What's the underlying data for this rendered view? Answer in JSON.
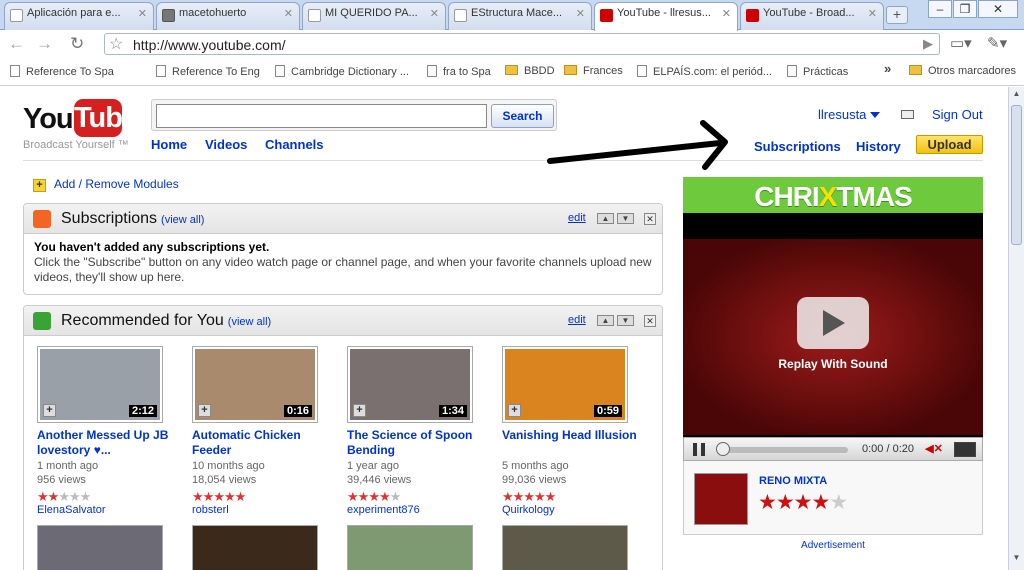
{
  "browser": {
    "tabs": [
      {
        "title": "Aplicación para e...",
        "icon": "page-icon"
      },
      {
        "title": "macetohuerto",
        "icon": "apple-icon"
      },
      {
        "title": "MI QUERIDO PA...",
        "icon": "page-icon"
      },
      {
        "title": "EStructura Mace...",
        "icon": "page-icon"
      },
      {
        "title": "YouTube - llresus...",
        "icon": "youtube-icon"
      },
      {
        "title": "YouTube - Broad...",
        "icon": "youtube-icon"
      }
    ],
    "url": "http://www.youtube.com/",
    "bookmarks": [
      {
        "label": "Reference To Spa",
        "icon": "page"
      },
      {
        "label": "Reference To Eng",
        "icon": "page"
      },
      {
        "label": "Cambridge Dictionary ...",
        "icon": "page"
      },
      {
        "label": "fra to Spa",
        "icon": "page"
      },
      {
        "label": "BBDD",
        "icon": "folder"
      },
      {
        "label": "Frances",
        "icon": "folder"
      },
      {
        "label": "ELPAÍS.com: el periód...",
        "icon": "page"
      },
      {
        "label": "Prácticas",
        "icon": "page"
      }
    ],
    "overflow": "»",
    "other_bookmarks": "Otros marcadores"
  },
  "header": {
    "logo_you": "You",
    "logo_tube": "Tube",
    "tagline": "Broadcast Yourself ™",
    "search_button": "Search",
    "nav": [
      "Home",
      "Videos",
      "Channels"
    ],
    "username": "llresusta",
    "sign_out": "Sign Out",
    "subscriptions": "Subscriptions",
    "history": "History",
    "upload": "Upload"
  },
  "add_modules": "Add / Remove Modules",
  "subscriptions_module": {
    "title": "Subscriptions",
    "view_all": "(view all)",
    "edit": "edit",
    "empty_title": "You haven't added any subscriptions yet.",
    "empty_text": "Click the \"Subscribe\" button on any video watch page or channel page, and when your favorite channels upload new videos, they'll show up here."
  },
  "recommended_module": {
    "title": "Recommended for You",
    "view_all": "(view all)",
    "edit": "edit",
    "videos": [
      {
        "title": "Another Messed Up JB lovestory ♥...",
        "age": "1 month ago",
        "views": "956 views",
        "rating": 2,
        "user": "ElenaSalvator",
        "duration": "2:12",
        "thumb_color": "#9aa0a8"
      },
      {
        "title": "Automatic Chicken Feeder",
        "age": "10 months ago",
        "views": "18,054 views",
        "rating": 5,
        "user": "robsterl",
        "duration": "0:16",
        "thumb_color": "#a98a6c"
      },
      {
        "title": "The Science of Spoon Bending",
        "age": "1 year ago",
        "views": "39,446 views",
        "rating": 4,
        "user": "experiment876",
        "duration": "1:34",
        "thumb_color": "#7a7070"
      },
      {
        "title": "Vanishing Head Illusion",
        "age": "5 months ago",
        "views": "99,036 views",
        "rating": 5,
        "user": "Quirkology",
        "duration": "0:59",
        "thumb_color": "#d9841f"
      }
    ]
  },
  "ad": {
    "banner_pre": "CHRI",
    "banner_x": "X",
    "banner_post": "TMAS",
    "replay": "Replay With Sound",
    "time": "0:00 / 0:20",
    "progress": 0,
    "channel": "RENO MIXTA",
    "rating": 4,
    "label": "Advertisement"
  },
  "colors": {
    "link": "#0033cc",
    "youtube_red": "#d61f1f",
    "upload_yellow": "#f3c10e",
    "ad_green": "#6fc93c"
  }
}
